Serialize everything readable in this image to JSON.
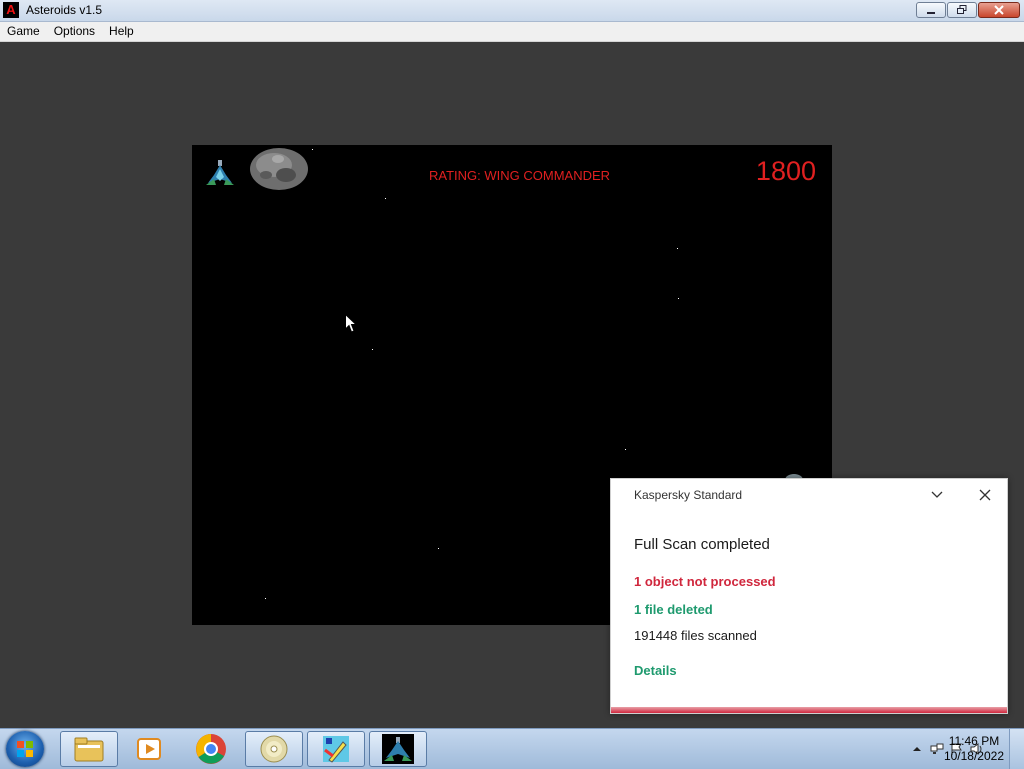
{
  "window": {
    "title": "Asteroids v1.5",
    "icon_letter": "A",
    "minimize_icon": "minimize-icon",
    "maximize_icon": "restore-icon",
    "close_icon": "close-icon"
  },
  "menu": {
    "items": [
      "Game",
      "Options",
      "Help"
    ]
  },
  "game": {
    "rating": "RATING: WING COMMANDER",
    "score": "1800",
    "lives": 1,
    "colors": {
      "text": "#e02020",
      "background": "#000000"
    }
  },
  "notification": {
    "app": "Kaspersky Standard",
    "title": "Full Scan completed",
    "not_processed": "1 object not processed",
    "deleted": "1 file deleted",
    "scanned": "191448 files scanned",
    "details_link": "Details",
    "colors": {
      "warning": "#d0273d",
      "success": "#1e9a6e"
    }
  },
  "taskbar": {
    "items": [
      {
        "name": "windows-explorer-icon",
        "active": true
      },
      {
        "name": "media-player-icon",
        "active": false
      },
      {
        "name": "chrome-icon",
        "active": false
      },
      {
        "name": "disc-icon",
        "active": true
      },
      {
        "name": "paint-icon",
        "active": true
      },
      {
        "name": "asteroids-icon",
        "active": true
      }
    ],
    "clock_time": "11:46 PM",
    "clock_date": "10/18/2022"
  }
}
